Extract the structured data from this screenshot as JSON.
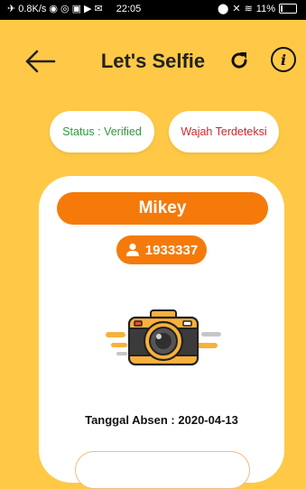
{
  "status_bar": {
    "network_speed": "0.8K/s",
    "time": "22:05",
    "battery": "11%"
  },
  "header": {
    "title": "Let's Selfie",
    "info_glyph": "i"
  },
  "badges": {
    "status": "Status : Verified",
    "face": "Wajah Terdeteksi"
  },
  "profile": {
    "name": "Mikey",
    "id": "1933337"
  },
  "attendance": {
    "label": "Tanggal Absen : ",
    "date": "2020-04-13"
  },
  "colors": {
    "background": "#ffc947",
    "accent": "#f57a0a",
    "verified_text": "#2e9a3b",
    "face_text": "#d1272b"
  },
  "icons": {
    "back": "arrow-left-icon",
    "refresh": "refresh-icon",
    "info": "info-icon",
    "user": "user-icon",
    "camera": "camera-icon"
  }
}
